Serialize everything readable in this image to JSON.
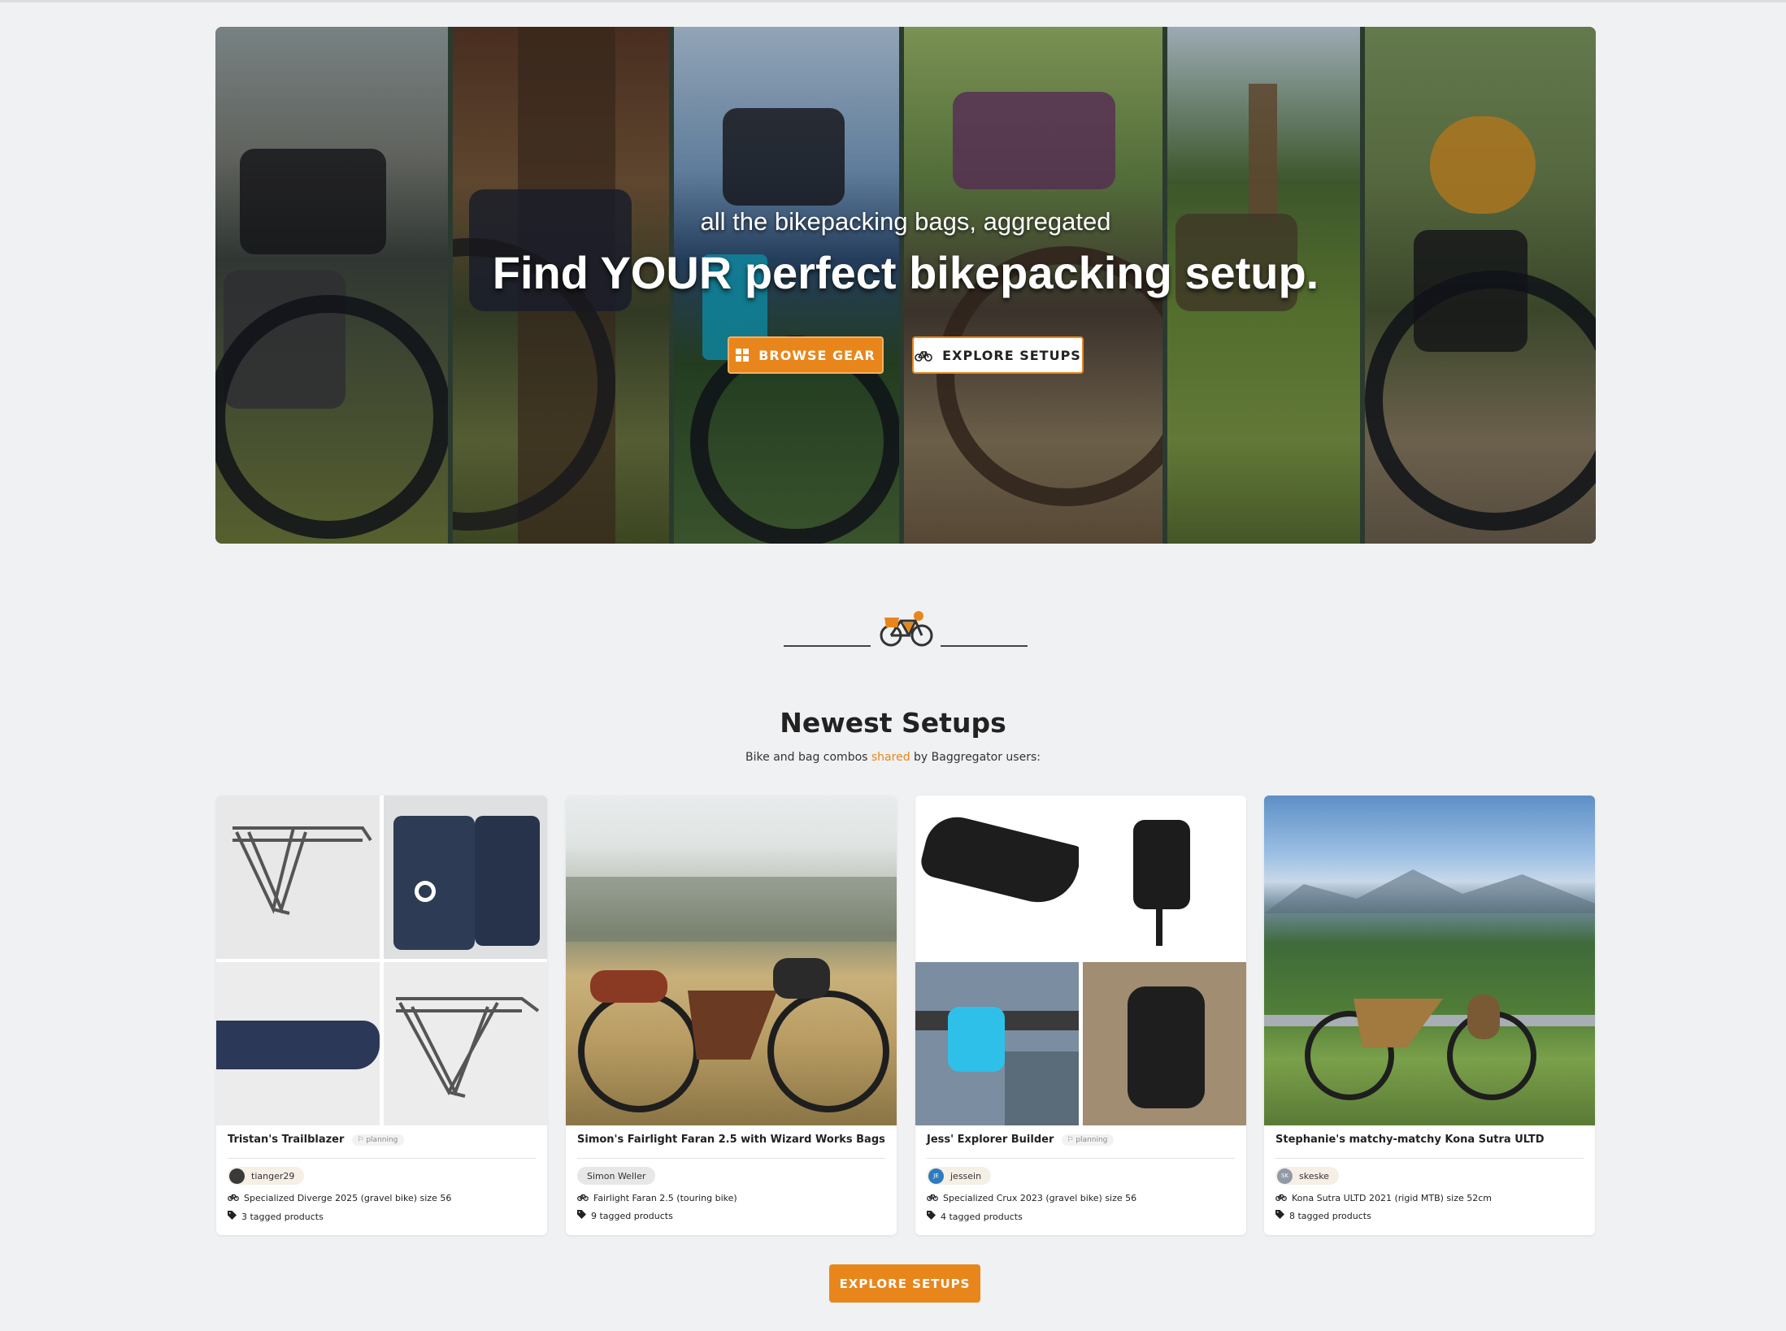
{
  "hero": {
    "subtitle": "all the bikepacking bags, aggregated",
    "title": "Find YOUR perfect bikepacking setup.",
    "browse_label": "BROWSE GEAR",
    "explore_label": "EXPLORE SETUPS"
  },
  "section": {
    "title": "Newest Setups",
    "subtitle_pre": "Bike and bag combos ",
    "subtitle_highlight": "shared",
    "subtitle_post": " by Baggregator users:"
  },
  "cards": [
    {
      "name": "Tristan's Trailblazer",
      "status": "planning",
      "user": "tianger29",
      "bike": "Specialized Diverge 2025 (gravel bike) size 56",
      "products": "3 tagged products"
    },
    {
      "name": "Simon's Fairlight Faran 2.5 with Wizard Works Bags",
      "user": "Simon Weller",
      "bike": "Fairlight Faran 2.5 (touring bike)",
      "products": "9 tagged products"
    },
    {
      "name": "Jess' Explorer Builder",
      "status": "planning",
      "user": "jessein",
      "user_initials": "JE",
      "bike": "Specialized Crux 2023 (gravel bike) size 56",
      "products": "4 tagged products"
    },
    {
      "name": "Stephanie's matchy-matchy Kona Sutra ULTD",
      "user": "skeske",
      "user_initials": "SK",
      "bike": "Kona Sutra ULTD 2021 (rigid MTB) size 52cm",
      "products": "8 tagged products"
    }
  ],
  "bottom_button": "EXPLORE SETUPS",
  "colors": {
    "accent": "#e8861c",
    "background": "#f0f1f3"
  },
  "icons": {
    "grid": "grid-icon",
    "bike": "bicycle-icon",
    "tag": "tag-icon",
    "logo": "bike-logo-icon"
  }
}
